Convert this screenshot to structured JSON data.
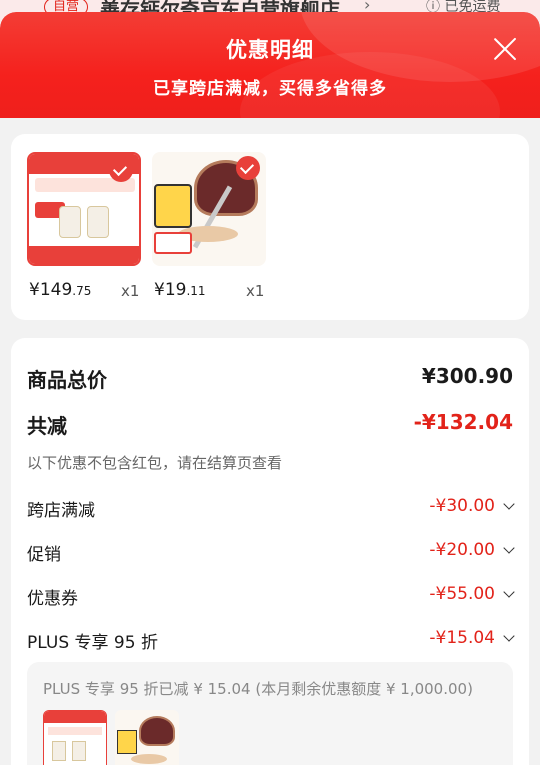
{
  "background_store": {
    "tag": "自营",
    "name": "善存钙尔奇京东自营旗舰店",
    "chevron": "›",
    "shipping": "ⓘ 已免运费"
  },
  "header": {
    "title": "优惠明细",
    "subtitle": "已享跨店满减，买得多省得多"
  },
  "products": [
    {
      "price_int": "¥149",
      "price_dec": ".75",
      "qty": "x1",
      "icon": "supplement-product-image"
    },
    {
      "price_int": "¥19",
      "price_dec": ".11",
      "qty": "x1",
      "icon": "mop-product-image"
    }
  ],
  "summary": {
    "total_label": "商品总价",
    "total_value": "¥300.90",
    "reduce_label": "共减",
    "reduce_value": "-¥132.04",
    "note": "以下优惠不包含红包，请在结算页查看",
    "discounts": [
      {
        "label": "跨店满减",
        "value": "-¥30.00"
      },
      {
        "label": "促销",
        "value": "-¥20.00"
      },
      {
        "label": "优惠券",
        "value": "-¥55.00"
      },
      {
        "label": "PLUS 专享 95 折",
        "value": "-¥15.04"
      }
    ],
    "plus_detail": "PLUS 专享 95 折已减 ¥ 15.04 (本月剩余优惠额度 ¥ 1,000.00)"
  },
  "colors": {
    "accent_red": "#e2231a",
    "header_red": "#f5211d"
  }
}
